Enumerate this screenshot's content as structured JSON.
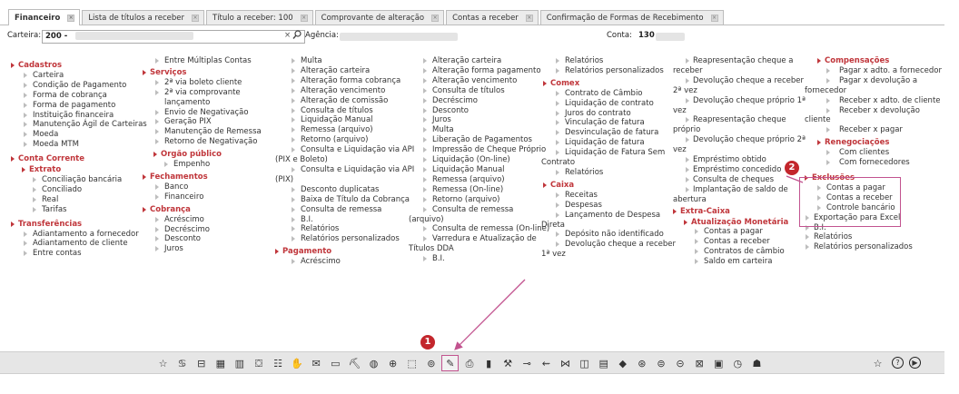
{
  "tabs": [
    {
      "label": "Financeiro",
      "active": true
    },
    {
      "label": "Lista de títulos a receber"
    },
    {
      "label": "Título a receber: 100"
    },
    {
      "label": "Comprovante de alteração"
    },
    {
      "label": "Contas a receber"
    },
    {
      "label": "Confirmação de Formas de Recebimento"
    }
  ],
  "search": {
    "carteira_label": "Carteira:",
    "carteira_value": "200 -",
    "clear_glyph": "×",
    "agencia_label": "Agência:",
    "conta_label": "Conta:",
    "conta_value": "130"
  },
  "col1": {
    "cadastros": "Cadastros",
    "cad_items": [
      "Carteira",
      "Condição de Pagamento",
      "Forma de cobrança",
      "Forma de pagamento",
      "Instituição financeira",
      "Manutenção Ágil de Carteiras",
      "Moeda",
      "Moeda MTM"
    ],
    "conta_corrente": "Conta Corrente",
    "extrato": "Extrato",
    "ext_items": [
      "Conciliação bancária",
      "Conciliado",
      "Real",
      "Tarifas"
    ],
    "transferencias": "Transferências",
    "tr_items": [
      "Adiantamento a fornecedor",
      "Adiantamento de cliente",
      "Entre contas"
    ]
  },
  "col2": {
    "top_item": "Entre Múltiplas Contas",
    "servicos": "Serviços",
    "serv_items": [
      "2ª via boleto cliente",
      "2ª via comprovante lançamento",
      "Envio de Negativação",
      "Geração PIX",
      "Manutenção de Remessa",
      "Retorno de Negativação"
    ],
    "orgao": "Orgão público",
    "orgao_items": [
      "Empenho"
    ],
    "fechamentos": "Fechamentos",
    "fech_items": [
      "Banco",
      "Financeiro"
    ],
    "cobranca": "Cobrança",
    "cob_items": [
      "Acréscimo",
      "Decréscimo",
      "Desconto",
      "Juros"
    ]
  },
  "col3": {
    "items_a": [
      "Multa",
      "Alteração carteira",
      "Alteração forma cobrança",
      "Alteração vencimento",
      "Alteração de comissão",
      "Consulta de títulos",
      "Liquidação Manual",
      "Remessa (arquivo)",
      "Retorno (arquivo)"
    ],
    "pix1_a": "Consulta e Liquidação via API",
    "pix1_b": "(PIX e Boleto)",
    "pix2_a": "Consulta e Liquidação via API",
    "pix2_b": "(PIX)",
    "items_b": [
      "Desconto duplicatas",
      "Baixa de Título da Cobrança",
      "Consulta de remessa",
      "B.I.",
      "Relatórios",
      "Relatórios personalizados"
    ],
    "pagamento": "Pagamento",
    "pag_items": [
      "Acréscimo"
    ]
  },
  "col4": {
    "items_a": [
      "Alteração carteira",
      "Alteração forma pagamento",
      "Alteração vencimento",
      "Consulta de títulos",
      "Decréscimo",
      "Desconto",
      "Juros",
      "Multa",
      "Liberação de Pagamentos",
      "Impressão de Cheque Próprio",
      "Liquidação (On-line)",
      "Liquidação Manual",
      "Remessa (arquivo)",
      "Remessa (On-line)",
      "Retorno (arquivo)"
    ],
    "rem_a": "Consulta de remessa",
    "rem_b": "(arquivo)",
    "rem_online": "Consulta de remessa (On-line)",
    "varr_a": "Varredura e Atualização de",
    "varr_b": "Títulos DDA",
    "bi": "B.I."
  },
  "col5": {
    "items_a": [
      "Relatórios",
      "Relatórios personalizados"
    ],
    "comex": "Comex",
    "comex_items": [
      "Contrato de Câmbio",
      "Liquidação de contrato",
      "Juros do contrato",
      "Vinculação de fatura",
      "Desvinculação de fatura",
      "Liquidação de fatura"
    ],
    "liqsem_a": "Liquidação de Fatura Sem",
    "liqsem_b": "Contrato",
    "comex_rel": "Relatórios",
    "caixa": "Caixa",
    "caixa_items": [
      "Receitas",
      "Despesas"
    ],
    "lanc_a": "Lançamento de Despesa",
    "lanc_b": "Direta",
    "dep": "Depósito não identificado",
    "dev_a": "Devolução cheque a receber",
    "dev_b": "1ª vez"
  },
  "col6": {
    "reap1_a": "Reapresentação cheque a",
    "reap1_b": "receber",
    "dev_rec_a": "Devolução cheque a receber",
    "dev_rec_b": "2ª vez",
    "dev_pro1_a": "Devolução cheque próprio 1ª",
    "dev_pro1_b": "vez",
    "reap2_a": "Reapresentação cheque",
    "reap2_b": "próprio",
    "dev_pro2_a": "Devolução cheque próprio 2ª",
    "dev_pro2_b": "vez",
    "items": [
      "Empréstimo obtido",
      "Empréstimo concedido",
      "Consulta de cheques"
    ],
    "impl_a": "Implantação de saldo de",
    "impl_b": "abertura",
    "extra_caixa": "Extra-Caixa",
    "atualizacao": "Atualização Monetária",
    "at_items": [
      "Contas a pagar",
      "Contas a receber",
      "Contratos de câmbio",
      "Saldo em carteira"
    ]
  },
  "col7": {
    "compensacoes": "Compensações",
    "comp_item1": "Pagar x adto. a fornecedor",
    "comp_item2_a": "Pagar x devolução a",
    "comp_item2_b": "fornecedor",
    "comp_item3": "Receber x adto. de cliente",
    "comp_item4_a": "Receber x devolução",
    "comp_item4_b": "cliente",
    "comp_item5": "Receber x pagar",
    "renegociacoes": "Renegociações",
    "reneg_items": [
      "Com clientes",
      "Com fornecedores"
    ],
    "exclusoes": "Exclusões",
    "excl_items": [
      "Contas a pagar",
      "Contas a receber",
      "Controle bancário"
    ],
    "tail_items": [
      "Exportação para Excel",
      "B.I.",
      "Relatórios",
      "Relatórios personalizados"
    ]
  },
  "badges": {
    "one": "1",
    "two": "2"
  },
  "toolbar": {
    "icons": [
      "☆",
      "♋",
      "⊟",
      "▦",
      "▥",
      "⛋",
      "☷",
      "✋",
      "✉",
      "▭",
      "⛏",
      "◍",
      "⊕",
      "⬚",
      "⊚",
      "✎",
      "⎙",
      "▮",
      "⚒",
      "⊸",
      "⇜",
      "⋈",
      "◫",
      "▤",
      "◆",
      "⊛",
      "⊜",
      "⊝",
      "⊠",
      "▣",
      "◷",
      "☗"
    ],
    "selected_index": 15,
    "right_icons": [
      "☆",
      "?",
      "▶"
    ],
    "accent": "#c2538f"
  }
}
